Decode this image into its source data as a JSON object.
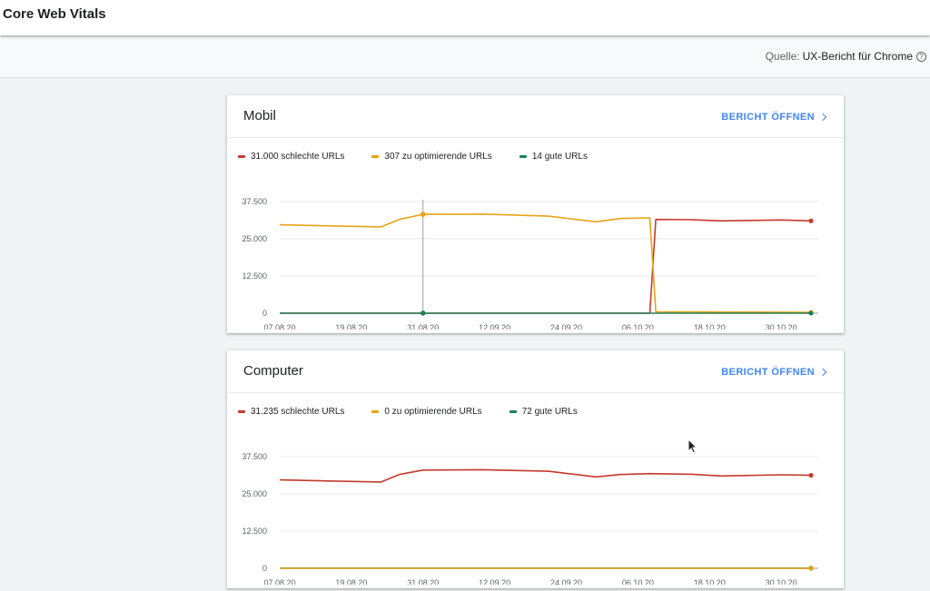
{
  "header": {
    "title": "Core Web Vitals"
  },
  "source": {
    "label": "Quelle:",
    "value": "UX-Bericht für Chrome",
    "help_icon": "?"
  },
  "colors": {
    "poor": "#c5392c",
    "needs_improvement": "#e8a317",
    "good": "#1e7e5a",
    "link": "#4285f4"
  },
  "cards": [
    {
      "title": "Mobil",
      "report_label": "BERICHT ÖFFNEN",
      "legend": [
        {
          "label": "31.000 schlechte URLs"
        },
        {
          "label": "307 zu optimierende URLs"
        },
        {
          "label": "14 gute URLs"
        }
      ]
    },
    {
      "title": "Computer",
      "report_label": "BERICHT ÖFFNEN",
      "legend": [
        {
          "label": "31.235 schlechte URLs"
        },
        {
          "label": "0 zu optimierende URLs"
        },
        {
          "label": "72 gute URLs"
        }
      ]
    }
  ],
  "chart_data": [
    {
      "type": "line",
      "title": "Mobil",
      "x_start": "2020-08-07",
      "x_end": "2020-11-04",
      "x_ticks": [
        "07.08.20",
        "19.08.20",
        "31.08.20",
        "12.09.20",
        "24.09.20",
        "06.10.20",
        "18.10.20",
        "30.10.20"
      ],
      "y_ticks": [
        "0",
        "12.500",
        "25.000",
        "37.500"
      ],
      "ylim": [
        0,
        37500
      ],
      "grid": true,
      "series": [
        {
          "name": "31.000 schlechte URLs",
          "color": "#c5392c",
          "points": [
            [
              "2020-08-07",
              0
            ],
            [
              "2020-10-08",
              0
            ],
            [
              "2020-10-09",
              31500
            ],
            [
              "2020-10-15",
              31400
            ],
            [
              "2020-10-20",
              31000
            ],
            [
              "2020-10-30",
              31300
            ],
            [
              "2020-11-04",
              31000
            ]
          ]
        },
        {
          "name": "307 zu optimierende URLs",
          "color": "#e8a317",
          "points": [
            [
              "2020-08-07",
              29700
            ],
            [
              "2020-08-16",
              29300
            ],
            [
              "2020-08-24",
              29000
            ],
            [
              "2020-08-27",
              31500
            ],
            [
              "2020-08-31",
              33200
            ],
            [
              "2020-09-10",
              33300
            ],
            [
              "2020-09-21",
              32600
            ],
            [
              "2020-09-29",
              30700
            ],
            [
              "2020-10-03",
              31800
            ],
            [
              "2020-10-08",
              32000
            ],
            [
              "2020-10-09",
              500
            ],
            [
              "2020-10-20",
              400
            ],
            [
              "2020-11-04",
              307
            ]
          ]
        },
        {
          "name": "14 gute URLs",
          "color": "#1e7e5a",
          "points": [
            [
              "2020-08-07",
              14
            ],
            [
              "2020-11-04",
              14
            ]
          ]
        }
      ],
      "hover": {
        "date": "2020-08-31",
        "markers": [
          [
            "#e8a317",
            33200
          ],
          [
            "#1e7e5a",
            14
          ]
        ]
      }
    },
    {
      "type": "line",
      "title": "Computer",
      "x_start": "2020-08-07",
      "x_end": "2020-11-04",
      "x_ticks": [
        "07.08.20",
        "19.08.20",
        "31.08.20",
        "12.09.20",
        "24.09.20",
        "06.10.20",
        "18.10.20",
        "30.10.20"
      ],
      "y_ticks": [
        "0",
        "12.500",
        "25.000",
        "37.500"
      ],
      "ylim": [
        0,
        37500
      ],
      "grid": true,
      "series": [
        {
          "name": "72 gute URLs",
          "color": "#1e7e5a",
          "points": [
            [
              "2020-08-07",
              72
            ],
            [
              "2020-11-04",
              72
            ]
          ]
        },
        {
          "name": "0 zu optimierende URLs",
          "color": "#e8a317",
          "points": [
            [
              "2020-08-07",
              0
            ],
            [
              "2020-11-04",
              0
            ]
          ]
        },
        {
          "name": "31.235 schlechte URLs",
          "color": "#c5392c",
          "points": [
            [
              "2020-08-07",
              29700
            ],
            [
              "2020-08-16",
              29300
            ],
            [
              "2020-08-24",
              29000
            ],
            [
              "2020-08-27",
              31500
            ],
            [
              "2020-08-31",
              33000
            ],
            [
              "2020-09-10",
              33100
            ],
            [
              "2020-09-21",
              32600
            ],
            [
              "2020-09-29",
              30700
            ],
            [
              "2020-10-03",
              31500
            ],
            [
              "2020-10-08",
              31800
            ],
            [
              "2020-10-15",
              31600
            ],
            [
              "2020-10-20",
              31000
            ],
            [
              "2020-10-30",
              31400
            ],
            [
              "2020-11-04",
              31235
            ]
          ]
        }
      ]
    }
  ]
}
